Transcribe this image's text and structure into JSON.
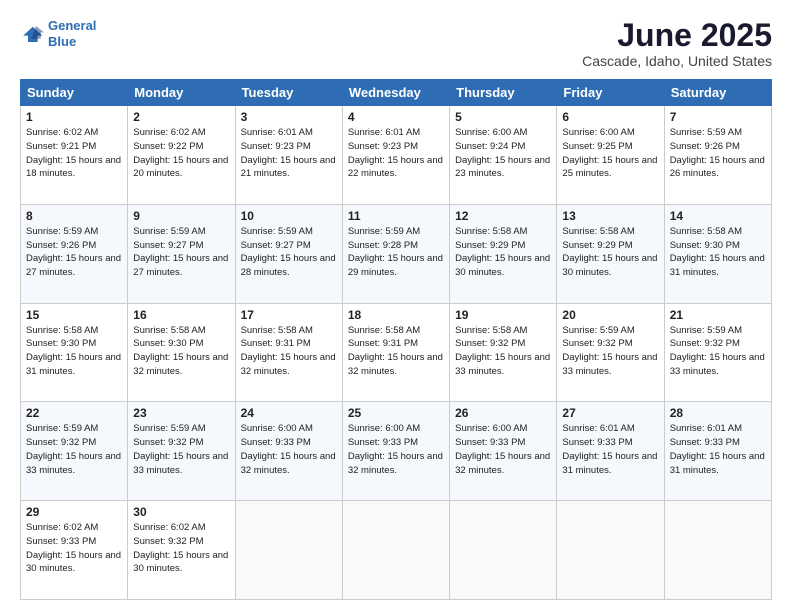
{
  "logo": {
    "line1": "General",
    "line2": "Blue"
  },
  "title": "June 2025",
  "subtitle": "Cascade, Idaho, United States",
  "header_days": [
    "Sunday",
    "Monday",
    "Tuesday",
    "Wednesday",
    "Thursday",
    "Friday",
    "Saturday"
  ],
  "weeks": [
    [
      {
        "day": "1",
        "sunrise": "6:02 AM",
        "sunset": "9:21 PM",
        "daylight": "15 hours and 18 minutes."
      },
      {
        "day": "2",
        "sunrise": "6:02 AM",
        "sunset": "9:22 PM",
        "daylight": "15 hours and 20 minutes."
      },
      {
        "day": "3",
        "sunrise": "6:01 AM",
        "sunset": "9:23 PM",
        "daylight": "15 hours and 21 minutes."
      },
      {
        "day": "4",
        "sunrise": "6:01 AM",
        "sunset": "9:23 PM",
        "daylight": "15 hours and 22 minutes."
      },
      {
        "day": "5",
        "sunrise": "6:00 AM",
        "sunset": "9:24 PM",
        "daylight": "15 hours and 23 minutes."
      },
      {
        "day": "6",
        "sunrise": "6:00 AM",
        "sunset": "9:25 PM",
        "daylight": "15 hours and 25 minutes."
      },
      {
        "day": "7",
        "sunrise": "5:59 AM",
        "sunset": "9:26 PM",
        "daylight": "15 hours and 26 minutes."
      }
    ],
    [
      {
        "day": "8",
        "sunrise": "5:59 AM",
        "sunset": "9:26 PM",
        "daylight": "15 hours and 27 minutes."
      },
      {
        "day": "9",
        "sunrise": "5:59 AM",
        "sunset": "9:27 PM",
        "daylight": "15 hours and 27 minutes."
      },
      {
        "day": "10",
        "sunrise": "5:59 AM",
        "sunset": "9:27 PM",
        "daylight": "15 hours and 28 minutes."
      },
      {
        "day": "11",
        "sunrise": "5:59 AM",
        "sunset": "9:28 PM",
        "daylight": "15 hours and 29 minutes."
      },
      {
        "day": "12",
        "sunrise": "5:58 AM",
        "sunset": "9:29 PM",
        "daylight": "15 hours and 30 minutes."
      },
      {
        "day": "13",
        "sunrise": "5:58 AM",
        "sunset": "9:29 PM",
        "daylight": "15 hours and 30 minutes."
      },
      {
        "day": "14",
        "sunrise": "5:58 AM",
        "sunset": "9:30 PM",
        "daylight": "15 hours and 31 minutes."
      }
    ],
    [
      {
        "day": "15",
        "sunrise": "5:58 AM",
        "sunset": "9:30 PM",
        "daylight": "15 hours and 31 minutes."
      },
      {
        "day": "16",
        "sunrise": "5:58 AM",
        "sunset": "9:30 PM",
        "daylight": "15 hours and 32 minutes."
      },
      {
        "day": "17",
        "sunrise": "5:58 AM",
        "sunset": "9:31 PM",
        "daylight": "15 hours and 32 minutes."
      },
      {
        "day": "18",
        "sunrise": "5:58 AM",
        "sunset": "9:31 PM",
        "daylight": "15 hours and 32 minutes."
      },
      {
        "day": "19",
        "sunrise": "5:58 AM",
        "sunset": "9:32 PM",
        "daylight": "15 hours and 33 minutes."
      },
      {
        "day": "20",
        "sunrise": "5:59 AM",
        "sunset": "9:32 PM",
        "daylight": "15 hours and 33 minutes."
      },
      {
        "day": "21",
        "sunrise": "5:59 AM",
        "sunset": "9:32 PM",
        "daylight": "15 hours and 33 minutes."
      }
    ],
    [
      {
        "day": "22",
        "sunrise": "5:59 AM",
        "sunset": "9:32 PM",
        "daylight": "15 hours and 33 minutes."
      },
      {
        "day": "23",
        "sunrise": "5:59 AM",
        "sunset": "9:32 PM",
        "daylight": "15 hours and 33 minutes."
      },
      {
        "day": "24",
        "sunrise": "6:00 AM",
        "sunset": "9:33 PM",
        "daylight": "15 hours and 32 minutes."
      },
      {
        "day": "25",
        "sunrise": "6:00 AM",
        "sunset": "9:33 PM",
        "daylight": "15 hours and 32 minutes."
      },
      {
        "day": "26",
        "sunrise": "6:00 AM",
        "sunset": "9:33 PM",
        "daylight": "15 hours and 32 minutes."
      },
      {
        "day": "27",
        "sunrise": "6:01 AM",
        "sunset": "9:33 PM",
        "daylight": "15 hours and 31 minutes."
      },
      {
        "day": "28",
        "sunrise": "6:01 AM",
        "sunset": "9:33 PM",
        "daylight": "15 hours and 31 minutes."
      }
    ],
    [
      {
        "day": "29",
        "sunrise": "6:02 AM",
        "sunset": "9:33 PM",
        "daylight": "15 hours and 30 minutes."
      },
      {
        "day": "30",
        "sunrise": "6:02 AM",
        "sunset": "9:32 PM",
        "daylight": "15 hours and 30 minutes."
      },
      null,
      null,
      null,
      null,
      null
    ]
  ]
}
